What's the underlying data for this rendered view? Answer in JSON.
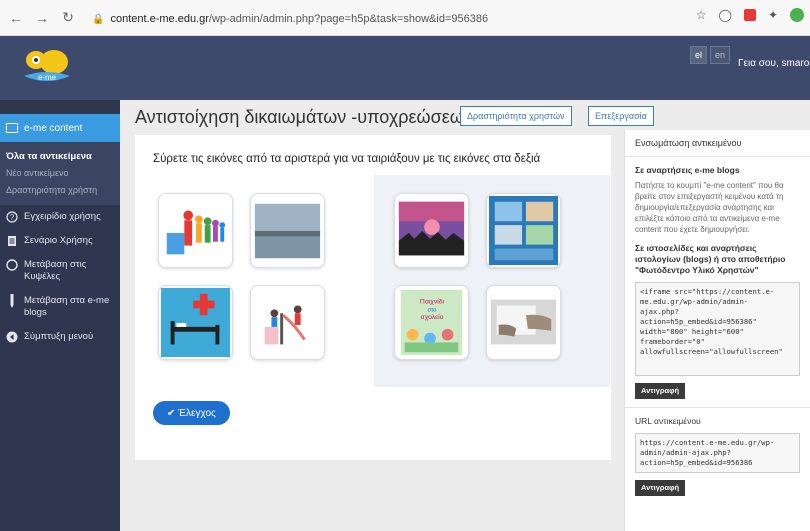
{
  "browser": {
    "url_host": "content.e-me.edu.gr",
    "url_path": "/wp-admin/admin.php?page=h5p&task=show&id=956386"
  },
  "topbar": {
    "lang_el": "el",
    "lang_en": "en",
    "greeting": "Γεια σου, smarou"
  },
  "sidebar": {
    "header": "e-me content",
    "sub_items": [
      "Όλα τα αντικείμενα",
      "Νέο αντικείμενο",
      "Δραστηριότητα χρήστη"
    ],
    "items": [
      {
        "label": "Εγχειρίδιο χρήσης",
        "icon": "help-icon"
      },
      {
        "label": "Σενάριο Χρήσης",
        "icon": "document-icon"
      },
      {
        "label": "Μετάβαση στις Κυψέλες",
        "icon": "hive-icon"
      },
      {
        "label": "Μετάβαση στα e-me blogs",
        "icon": "pen-icon"
      },
      {
        "label": "Σύμπτυξη μενού",
        "icon": "collapse-icon"
      }
    ]
  },
  "main": {
    "title": "Αντιστοίχηση δικαιωμάτων -υποχρεώσεων",
    "btn_activity": "Δραστηριότητα χρηστών",
    "btn_edit": "Επεξεργασία",
    "instruction": "Σύρετε τις εικόνες από τα αριστερά για να ταιριάξουν με τις εικόνες στα δεξιά",
    "book_text_1": "Παιχνίδι",
    "book_text_2": "στο",
    "book_text_3": "σχολείο",
    "check_label": "✔ Έλεγχος"
  },
  "embed": {
    "title": "Ενσωμάτωση αντικειμένου",
    "blogs_head": "Σε αναρτήσεις e-me blogs",
    "blogs_text": "Πατήστε το κουμπί \"e-me content\" που θα βρείτε στον επεξεργαστή κειμένου κατά τη δημιουργία/επεξεργασία ανάρτησης και επιλέξτε κάποιο από τα αντικείμενα e-me content που έχετε δημιουργήσει.",
    "sites_head": "Σε ιστοσελίδες και αναρτήσεις ιστολογίων (blogs) ή στο αποθετήριο \"Φωτόδεντρο Υλικό Χρηστών\"",
    "iframe_code": "<iframe src=\"https://content.e-\nme.edu.gr/wp-admin/admin-\najax.php?\naction=h5p_embed&id=956386\"\nwidth=\"800\" height=\"600\"\nframeborder=\"0\"\nallowfullscreen=\"allowfullscreen\"",
    "copy_label": "Αντιγραφή",
    "url_head": "URL αντικειμένου",
    "url_code": "https://content.e-me.edu.gr/wp-\nadmin/admin-ajax.php?\naction=h5p_embed&id=956386",
    "copy_label2": "Αντιγραφή"
  },
  "colors": {
    "appbar": "#3d4a6b",
    "sidebar": "#2e3650",
    "accent": "#3b9be0",
    "check_button": "#1f6fcf"
  }
}
